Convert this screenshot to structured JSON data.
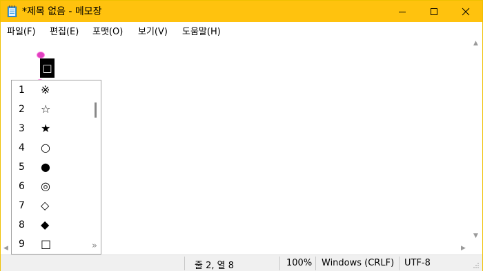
{
  "window": {
    "title": "*제목 없음 - 메모장",
    "accent": "#ffc20e"
  },
  "menu": [
    "파일(F)",
    "편집(E)",
    "포맷(O)",
    "보기(V)",
    "도움말(H)"
  ],
  "editor": {
    "selected_char": "□"
  },
  "candidates": {
    "items": [
      {
        "num": "1",
        "sym": "※"
      },
      {
        "num": "2",
        "sym": "☆"
      },
      {
        "num": "3",
        "sym": "★"
      },
      {
        "num": "4",
        "sym": "○"
      },
      {
        "num": "5",
        "sym": "●"
      },
      {
        "num": "6",
        "sym": "◎"
      },
      {
        "num": "7",
        "sym": "◇"
      },
      {
        "num": "8",
        "sym": "◆"
      },
      {
        "num": "9",
        "sym": "□"
      }
    ],
    "more_label": "»"
  },
  "status": {
    "position": "줄 2, 열 8",
    "zoom": "100%",
    "line_ending": "Windows (CRLF)",
    "encoding": "UTF-8"
  }
}
